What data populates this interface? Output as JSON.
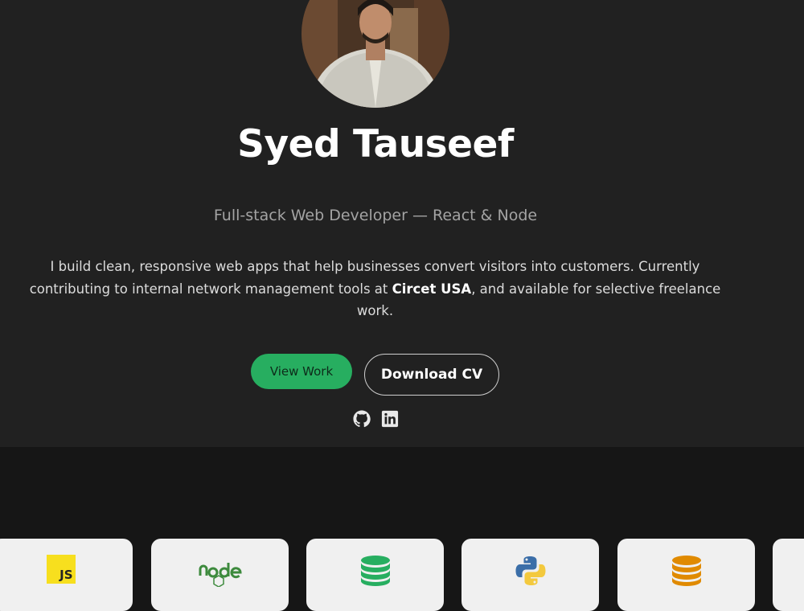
{
  "profile": {
    "name": "Syed Tauseef",
    "role": "Full-stack Web Developer — React & Node",
    "bio_part1": "I build clean, responsive web apps that help businesses convert visitors into customers. Currently contributing to internal network management tools at ",
    "bio_company": "Circet USA",
    "bio_part2": ", and available for selective freelance work."
  },
  "actions": {
    "view_work": "View Work",
    "download_cv": "Download CV"
  },
  "social": {
    "icons": [
      "github-icon",
      "linkedin-icon"
    ]
  },
  "skills": {
    "icons": [
      "javascript-icon",
      "nodejs-icon",
      "database-icon",
      "python-icon",
      "database-icon"
    ],
    "js_text": "JS",
    "colors": {
      "database_green": "#27ae60",
      "database_orange": "#e08a00",
      "javascript": "#f7df1e",
      "python_blue": "#3b6ea8",
      "python_yellow": "#f3c93e",
      "node_green": "#3d8a3d"
    }
  },
  "theme": {
    "hero_background": "#212121",
    "page_background": "#161616",
    "accent": "#27ae60"
  }
}
